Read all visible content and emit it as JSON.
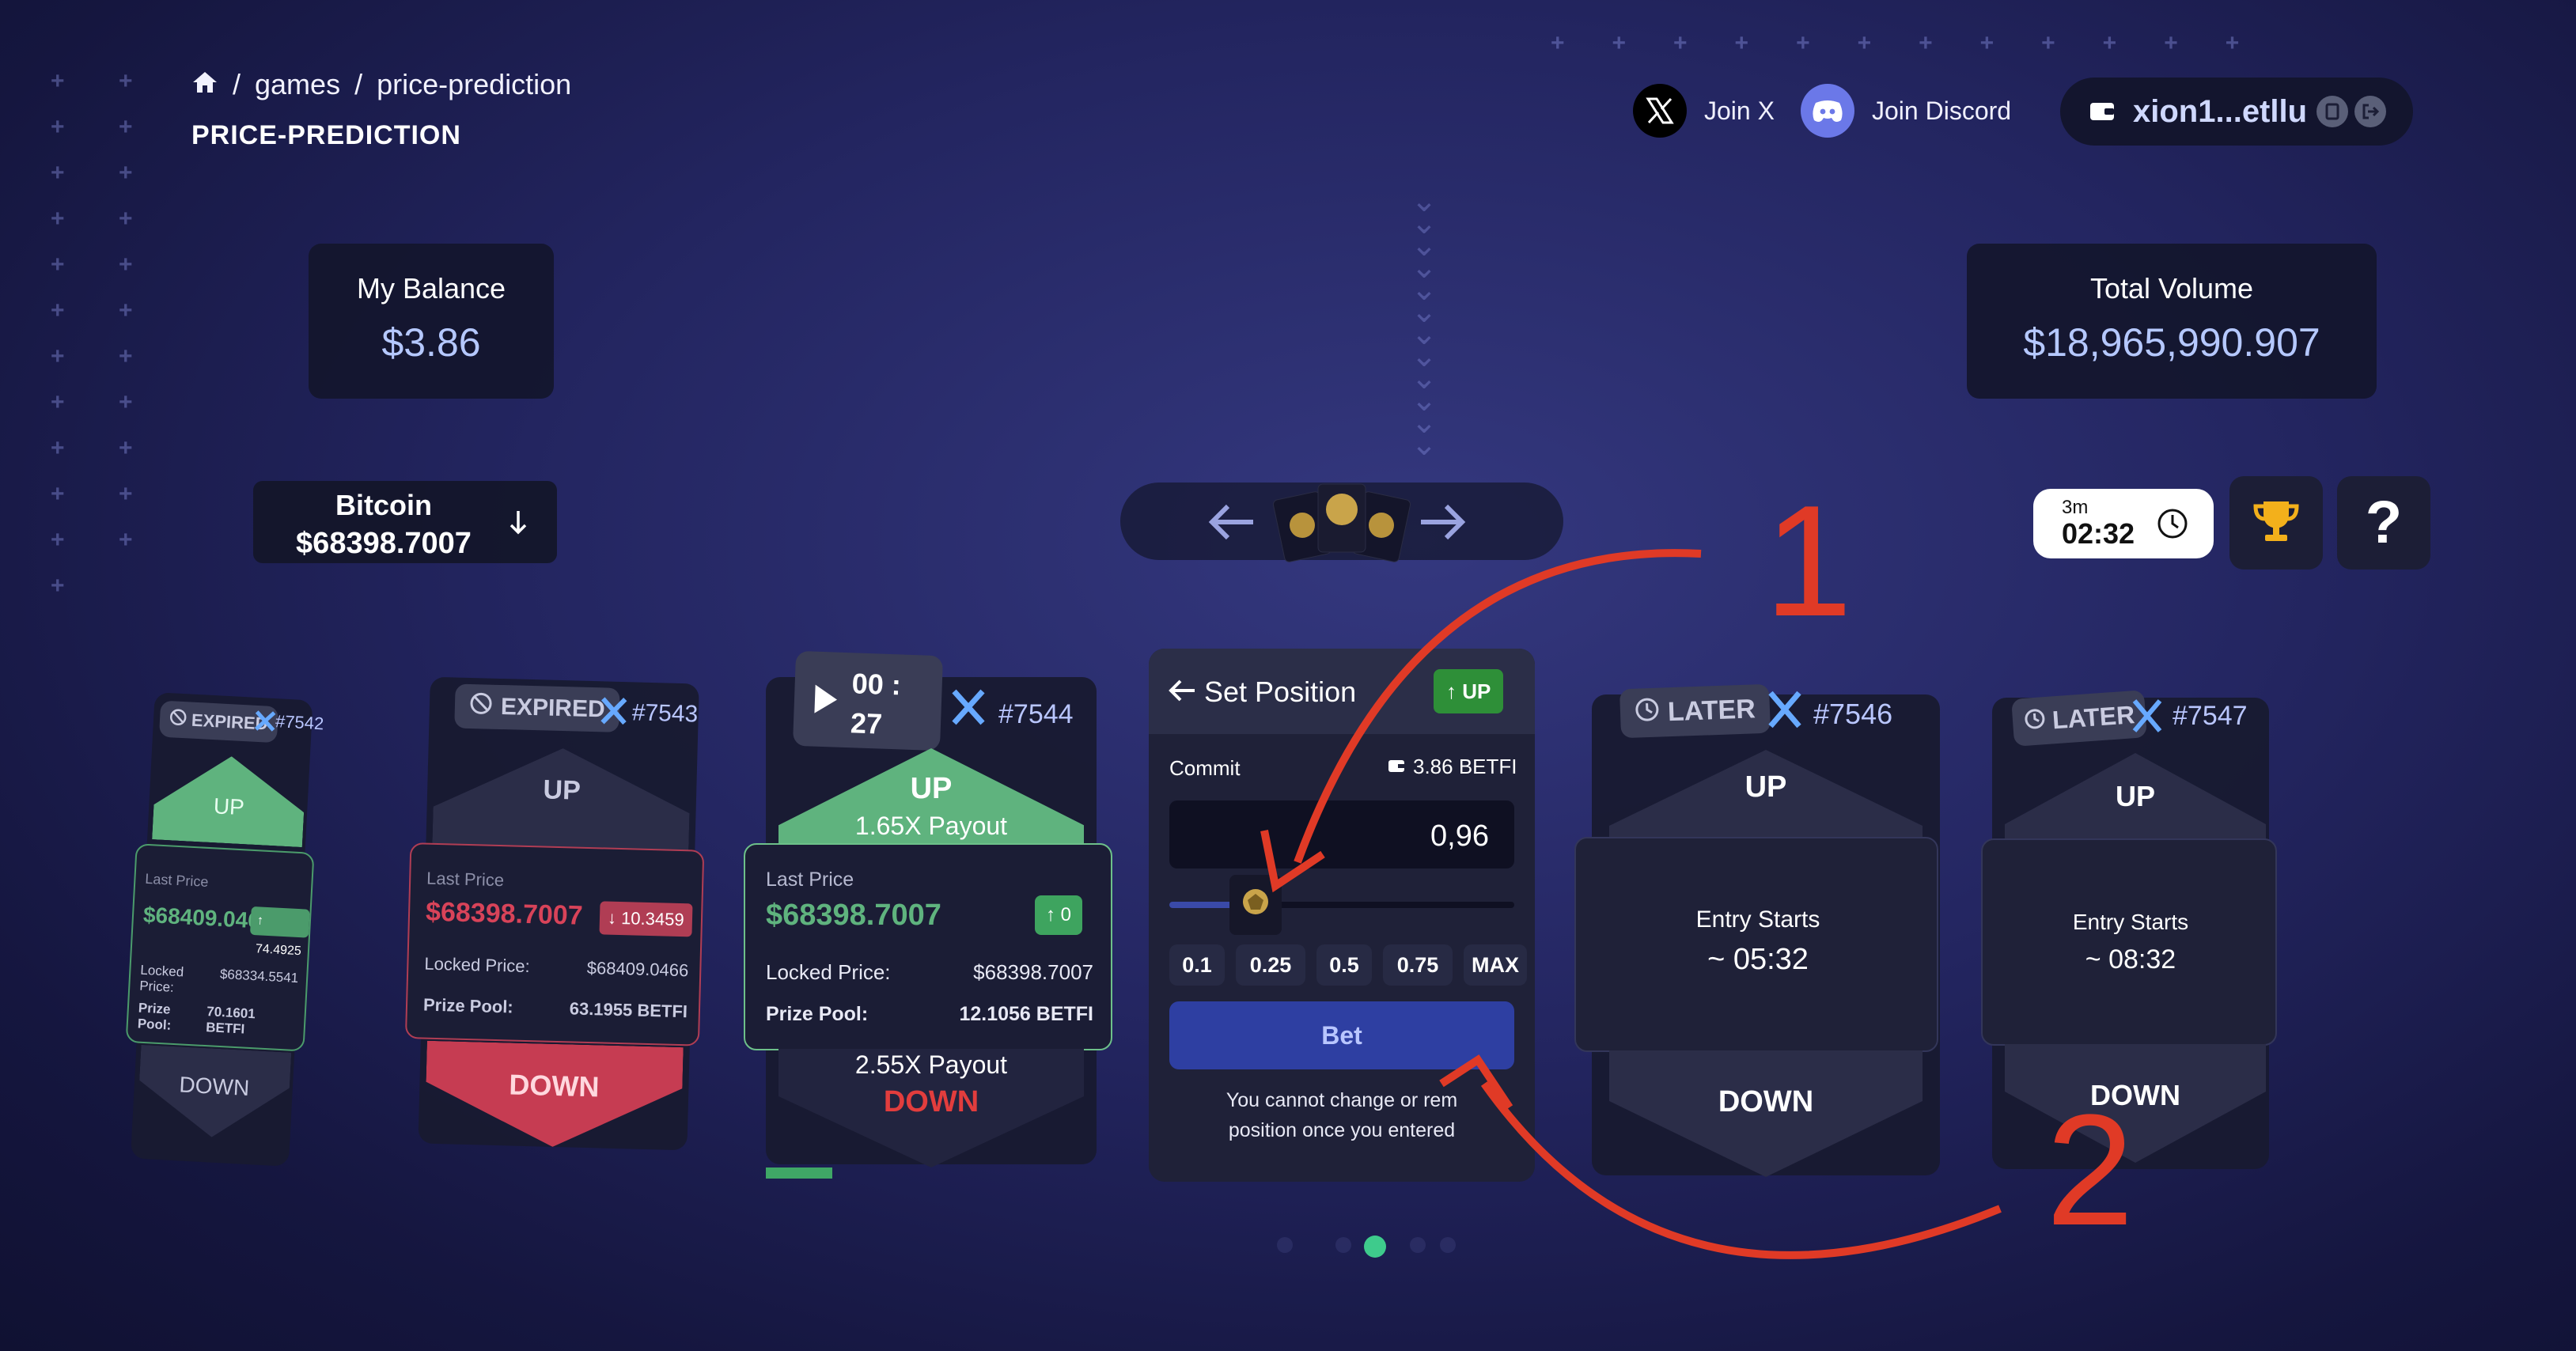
{
  "breadcrumb": {
    "sep1": "/",
    "games": "games",
    "sep2": "/",
    "current": "price-prediction"
  },
  "page_title": "PRICE-PREDICTION",
  "social": {
    "x_label": "Join X",
    "discord_label": "Join Discord"
  },
  "wallet": {
    "address": "xion1...etllu"
  },
  "balance": {
    "label": "My Balance",
    "value": "$3.86"
  },
  "volume": {
    "label": "Total Volume",
    "value": "$18,965,990.907"
  },
  "asset": {
    "name": "Bitcoin",
    "price": "$68398.7007"
  },
  "timer": {
    "interval": "3m",
    "countdown": "02:32"
  },
  "cards": {
    "c7542": {
      "status": "EXPIRED",
      "epoch": "#7542",
      "up": "UP",
      "down": "DOWN",
      "last_price_label": "Last Price",
      "last_price": "$68409.0466",
      "change": "74.4925",
      "locked_label": "Locked Price:",
      "locked": "$68334.5541",
      "pool_label": "Prize Pool:",
      "pool": "70.1601 BETFI"
    },
    "c7543": {
      "status": "EXPIRED",
      "epoch": "#7543",
      "up": "UP",
      "down": "DOWN",
      "last_price_label": "Last Price",
      "last_price": "$68398.7007",
      "change": "10.3459",
      "locked_label": "Locked Price:",
      "locked": "$68409.0466",
      "pool_label": "Prize Pool:",
      "pool": "63.1955 BETFI"
    },
    "c7544": {
      "time_min": "00 :",
      "time_sec": "27",
      "epoch": "#7544",
      "up": "UP",
      "up_payout": "1.65X Payout",
      "last_price_label": "Last Price",
      "last_price": "$68398.7007",
      "change": "0",
      "locked_label": "Locked Price:",
      "locked": "$68398.7007",
      "pool_label": "Prize Pool:",
      "pool": "12.1056 BETFI",
      "down_payout": "2.55X Payout",
      "down": "DOWN",
      "progress": 0.2
    },
    "c7546": {
      "status": "LATER",
      "epoch": "#7546",
      "up": "UP",
      "entry_label": "Entry Starts",
      "entry_time": "~ 05:32",
      "down": "DOWN"
    },
    "c7547": {
      "status": "LATER",
      "epoch": "#7547",
      "up": "UP",
      "entry_label": "Entry Starts",
      "entry_time": "~ 08:32",
      "down": "DOWN"
    }
  },
  "set_position": {
    "title": "Set Position",
    "direction": "UP",
    "commit_label": "Commit",
    "available": "3.86 BETFI",
    "amount": "0,96",
    "slider_fraction": 0.25,
    "presets": [
      "0.1",
      "0.25",
      "0.5",
      "0.75",
      "MAX"
    ],
    "bet_label": "Bet",
    "notice_line1": "You cannot change or rem",
    "notice_line2": "position once you entered"
  },
  "annotations": {
    "one": "1",
    "two": "2"
  },
  "colors": {
    "up_green": "#5fb37e",
    "down_red": "#d84359",
    "accent_blue": "#2e3fa2",
    "annotation_red": "#e03a26"
  }
}
